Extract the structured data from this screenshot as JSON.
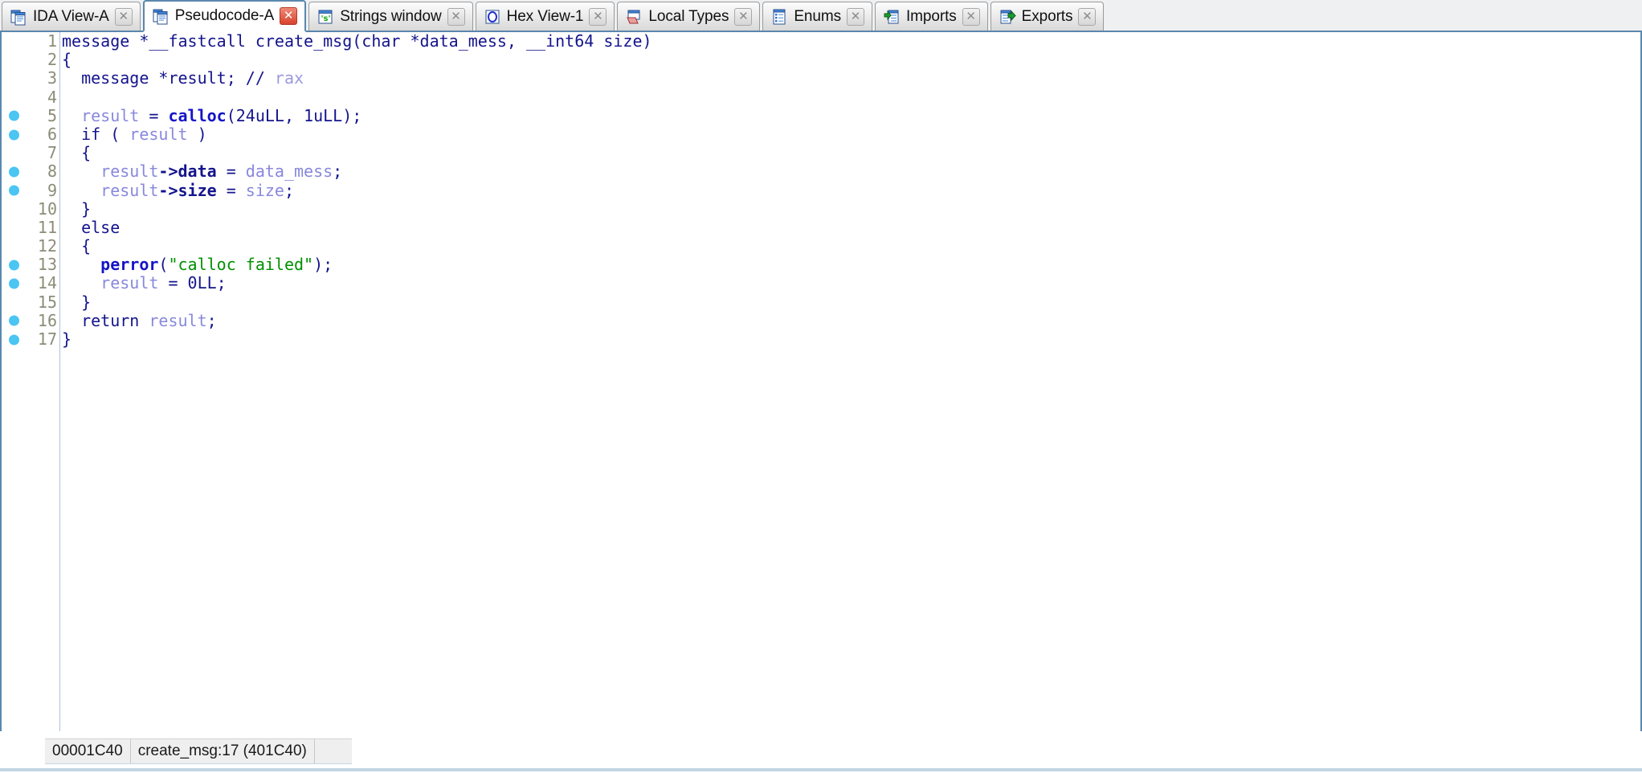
{
  "window": {
    "title": "Pseudocode-A",
    "accent_color": "#5a87ad",
    "code_color": "#14148c",
    "variable_color": "#8888dd",
    "function_color": "#1414c8",
    "string_color": "#009000",
    "comment_color": "#9a9ae0",
    "breakpoint_dot_color": "#4bc5f2"
  },
  "tabs": [
    {
      "label": "IDA View-A",
      "icon": "ida-view-icon",
      "active": false,
      "close_label": "✕"
    },
    {
      "label": "Pseudocode-A",
      "icon": "pseudocode-icon",
      "active": true,
      "close_label": "✕"
    },
    {
      "label": "Strings window",
      "icon": "strings-icon",
      "active": false,
      "close_label": "✕"
    },
    {
      "label": "Hex View-1",
      "icon": "hex-view-icon",
      "active": false,
      "close_label": "✕"
    },
    {
      "label": "Local Types",
      "icon": "local-types-icon",
      "active": false,
      "close_label": "✕"
    },
    {
      "label": "Enums",
      "icon": "enums-icon",
      "active": false,
      "close_label": "✕"
    },
    {
      "label": "Imports",
      "icon": "imports-icon",
      "active": false,
      "close_label": "✕"
    },
    {
      "label": "Exports",
      "icon": "exports-icon",
      "active": false,
      "close_label": "✕"
    }
  ],
  "code": {
    "language": "c-pseudocode",
    "function_name": "create_msg",
    "lines": [
      {
        "n": 1,
        "bp": false,
        "text": "message *__fastcall create_msg(char *data_mess, __int64 size)",
        "tokens": [
          {
            "t": "message *__fastcall ",
            "c": "kw"
          },
          {
            "t": "create_msg",
            "c": "kw"
          },
          {
            "t": "(char *",
            "c": "kw"
          },
          {
            "t": "data_mess",
            "c": "kw"
          },
          {
            "t": ", __int64 ",
            "c": "kw"
          },
          {
            "t": "size",
            "c": "kw"
          },
          {
            "t": ")",
            "c": "kw"
          }
        ]
      },
      {
        "n": 2,
        "bp": false,
        "text": "{",
        "tokens": [
          {
            "t": "{",
            "c": "kw"
          }
        ]
      },
      {
        "n": 3,
        "bp": false,
        "text": "  message *result; // rax",
        "tokens": [
          {
            "t": "  message *result; ",
            "c": "kw"
          },
          {
            "t": "//",
            "c": "cmtsl"
          },
          {
            "t": " rax",
            "c": "cmt"
          }
        ]
      },
      {
        "n": 4,
        "bp": false,
        "text": "",
        "tokens": [
          {
            "t": "",
            "c": "kw"
          }
        ]
      },
      {
        "n": 5,
        "bp": true,
        "text": "  result = calloc(24uLL, 1uLL);",
        "tokens": [
          {
            "t": "  ",
            "c": "kw"
          },
          {
            "t": "result",
            "c": "var"
          },
          {
            "t": " = ",
            "c": "kw"
          },
          {
            "t": "calloc",
            "c": "fn"
          },
          {
            "t": "(24uLL, 1uLL);",
            "c": "kw"
          }
        ]
      },
      {
        "n": 6,
        "bp": true,
        "text": "  if ( result )",
        "tokens": [
          {
            "t": "  if ( ",
            "c": "kw"
          },
          {
            "t": "result",
            "c": "var"
          },
          {
            "t": " )",
            "c": "kw"
          }
        ]
      },
      {
        "n": 7,
        "bp": false,
        "text": "  {",
        "tokens": [
          {
            "t": "  {",
            "c": "kw"
          }
        ]
      },
      {
        "n": 8,
        "bp": true,
        "text": "    result->data = data_mess;",
        "tokens": [
          {
            "t": "    ",
            "c": "kw"
          },
          {
            "t": "result",
            "c": "var"
          },
          {
            "t": "->data",
            "c": "mem"
          },
          {
            "t": " = ",
            "c": "kw"
          },
          {
            "t": "data_mess",
            "c": "var"
          },
          {
            "t": ";",
            "c": "kw"
          }
        ]
      },
      {
        "n": 9,
        "bp": true,
        "text": "    result->size = size;",
        "tokens": [
          {
            "t": "    ",
            "c": "kw"
          },
          {
            "t": "result",
            "c": "var"
          },
          {
            "t": "->size",
            "c": "mem"
          },
          {
            "t": " = ",
            "c": "kw"
          },
          {
            "t": "size",
            "c": "var"
          },
          {
            "t": ";",
            "c": "kw"
          }
        ]
      },
      {
        "n": 10,
        "bp": false,
        "text": "  }",
        "tokens": [
          {
            "t": "  }",
            "c": "kw"
          }
        ]
      },
      {
        "n": 11,
        "bp": false,
        "text": "  else",
        "tokens": [
          {
            "t": "  else",
            "c": "kw"
          }
        ]
      },
      {
        "n": 12,
        "bp": false,
        "text": "  {",
        "tokens": [
          {
            "t": "  {",
            "c": "kw"
          }
        ]
      },
      {
        "n": 13,
        "bp": true,
        "text": "    perror(\"calloc failed\");",
        "tokens": [
          {
            "t": "    ",
            "c": "kw"
          },
          {
            "t": "perror",
            "c": "fn"
          },
          {
            "t": "(",
            "c": "kw"
          },
          {
            "t": "\"calloc failed\"",
            "c": "str"
          },
          {
            "t": ");",
            "c": "kw"
          }
        ]
      },
      {
        "n": 14,
        "bp": true,
        "text": "    result = 0LL;",
        "tokens": [
          {
            "t": "    ",
            "c": "kw"
          },
          {
            "t": "result",
            "c": "var"
          },
          {
            "t": " = 0LL;",
            "c": "kw"
          }
        ]
      },
      {
        "n": 15,
        "bp": false,
        "text": "  }",
        "tokens": [
          {
            "t": "  }",
            "c": "kw"
          }
        ]
      },
      {
        "n": 16,
        "bp": true,
        "text": "  return result;",
        "tokens": [
          {
            "t": "  return ",
            "c": "kw"
          },
          {
            "t": "result",
            "c": "var"
          },
          {
            "t": ";",
            "c": "kw"
          }
        ]
      },
      {
        "n": 17,
        "bp": true,
        "text": "}",
        "tokens": [
          {
            "t": "}",
            "c": "kw"
          }
        ]
      }
    ]
  },
  "status": {
    "offset": "00001C40",
    "location": "create_msg:17 (401C40)",
    "extra": ""
  }
}
